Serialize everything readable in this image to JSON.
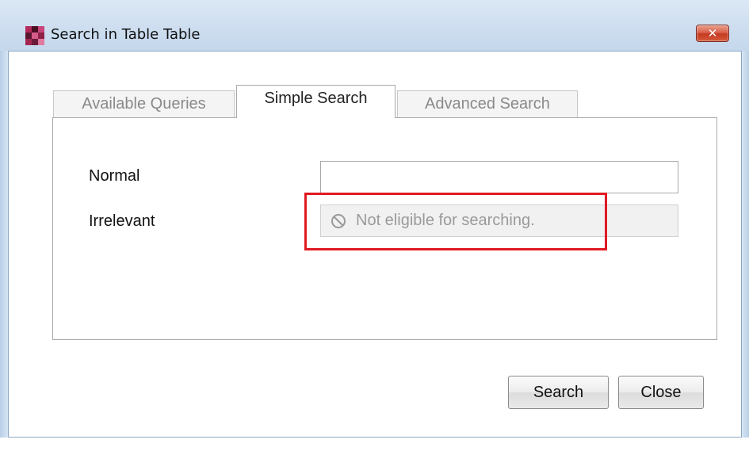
{
  "window": {
    "title": "Search in Table Table",
    "close_glyph": "✕",
    "app_icon": "app-logo-icon",
    "accent_colors": {
      "frame": "#c9dcef",
      "close_button": "#c43b22",
      "highlight": "#e01a22"
    }
  },
  "tabs": [
    {
      "label": "Available Queries",
      "active": false
    },
    {
      "label": "Simple Search",
      "active": true
    },
    {
      "label": "Advanced Search",
      "active": false
    }
  ],
  "form": {
    "normal_label": "Normal",
    "normal_value": "",
    "irrelevant_label": "Irrelevant",
    "irrelevant_message": "Not eligible for searching.",
    "irrelevant_icon": "not-allowed-icon"
  },
  "buttons": {
    "search_label": "Search",
    "close_label": "Close"
  }
}
